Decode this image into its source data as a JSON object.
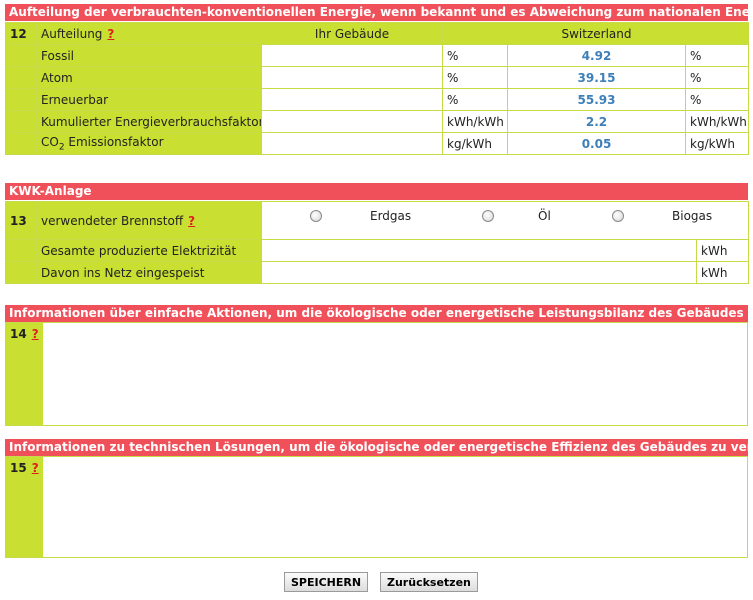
{
  "section12": {
    "header": "Aufteilung der verbrauchten-konventionellen Energie, wenn bekannt und es Abweichung zum nationalen Energiemix gibt",
    "num": "12",
    "label": "Aufteilung",
    "help": "?",
    "col_building": "Ihr Gebäude",
    "col_country": "Switzerland",
    "rows": [
      {
        "label": "Fossil",
        "unit": "%",
        "value": "4.92",
        "unit2": "%"
      },
      {
        "label": "Atom",
        "unit": "%",
        "value": "39.15",
        "unit2": "%"
      },
      {
        "label": "Erneuerbar",
        "unit": "%",
        "value": "55.93",
        "unit2": "%"
      },
      {
        "label": "Kumulierter Energieverbrauchsfaktor",
        "unit": "kWh/kWh",
        "value": "2.2",
        "unit2": "kWh/kWh"
      },
      {
        "label_pre": "CO",
        "label_sub": "2",
        "label_post": " Emissionsfaktor",
        "unit": "kg/kWh",
        "value": "0.05",
        "unit2": "kg/kWh"
      }
    ]
  },
  "section13": {
    "header": "KWK-Anlage",
    "num": "13",
    "label": "verwendeter Brennstoff",
    "help": "?",
    "options": [
      "Erdgas",
      "Öl",
      "Biogas"
    ],
    "rows": [
      {
        "label": "Gesamte produzierte Elektrizität",
        "unit": "kWh"
      },
      {
        "label": "Davon ins Netz eingespeist",
        "unit": "kWh"
      }
    ]
  },
  "section14": {
    "header": "Informationen über einfache Aktionen, um die ökologische oder energetische Leistungsbilanz des Gebäudes zu verbessern.",
    "num": "14",
    "help": "?",
    "value": ""
  },
  "section15": {
    "header": "Informationen zu technischen Lösungen, um die ökologische oder energetische Effizienz des Gebäudes zu verbessern.",
    "num": "15",
    "help": "?",
    "value": ""
  },
  "buttons": {
    "save": "SPEICHERN",
    "reset": "Zurücksetzen"
  },
  "colors": {
    "header_red": "#f0505a",
    "label_green": "#c9e033",
    "value_blue": "#3d7fb8",
    "help_red": "#e0201e"
  }
}
